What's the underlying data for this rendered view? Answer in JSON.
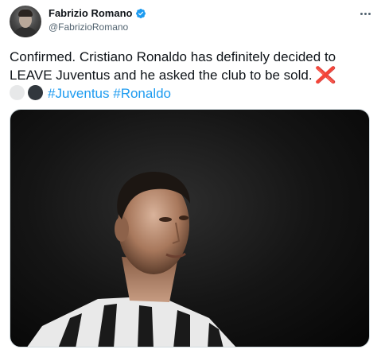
{
  "tweet": {
    "author": {
      "display_name": "Fabrizio Romano",
      "handle": "@FabrizioRomano",
      "verified_icon": "verified-badge-icon",
      "avatar_icon": "avatar"
    },
    "menu_icon": "more-options-icon",
    "text_line1": "Confirmed. Cristiano Ronaldo has definitely decided to",
    "text_line2": "LEAVE Juventus and he asked the club to be sold.",
    "emoji_cross": "❌",
    "emoji_white_circle": "white-circle-emoji",
    "emoji_black_circle": "black-circle-emoji",
    "hashtags": [
      "#Juventus",
      "#Ronaldo"
    ],
    "media": {
      "icon": "photo-image"
    }
  },
  "colors": {
    "link": "#1d9bf0",
    "text": "#0f1419",
    "secondary": "#536471",
    "cross_red": "#e0312b"
  }
}
